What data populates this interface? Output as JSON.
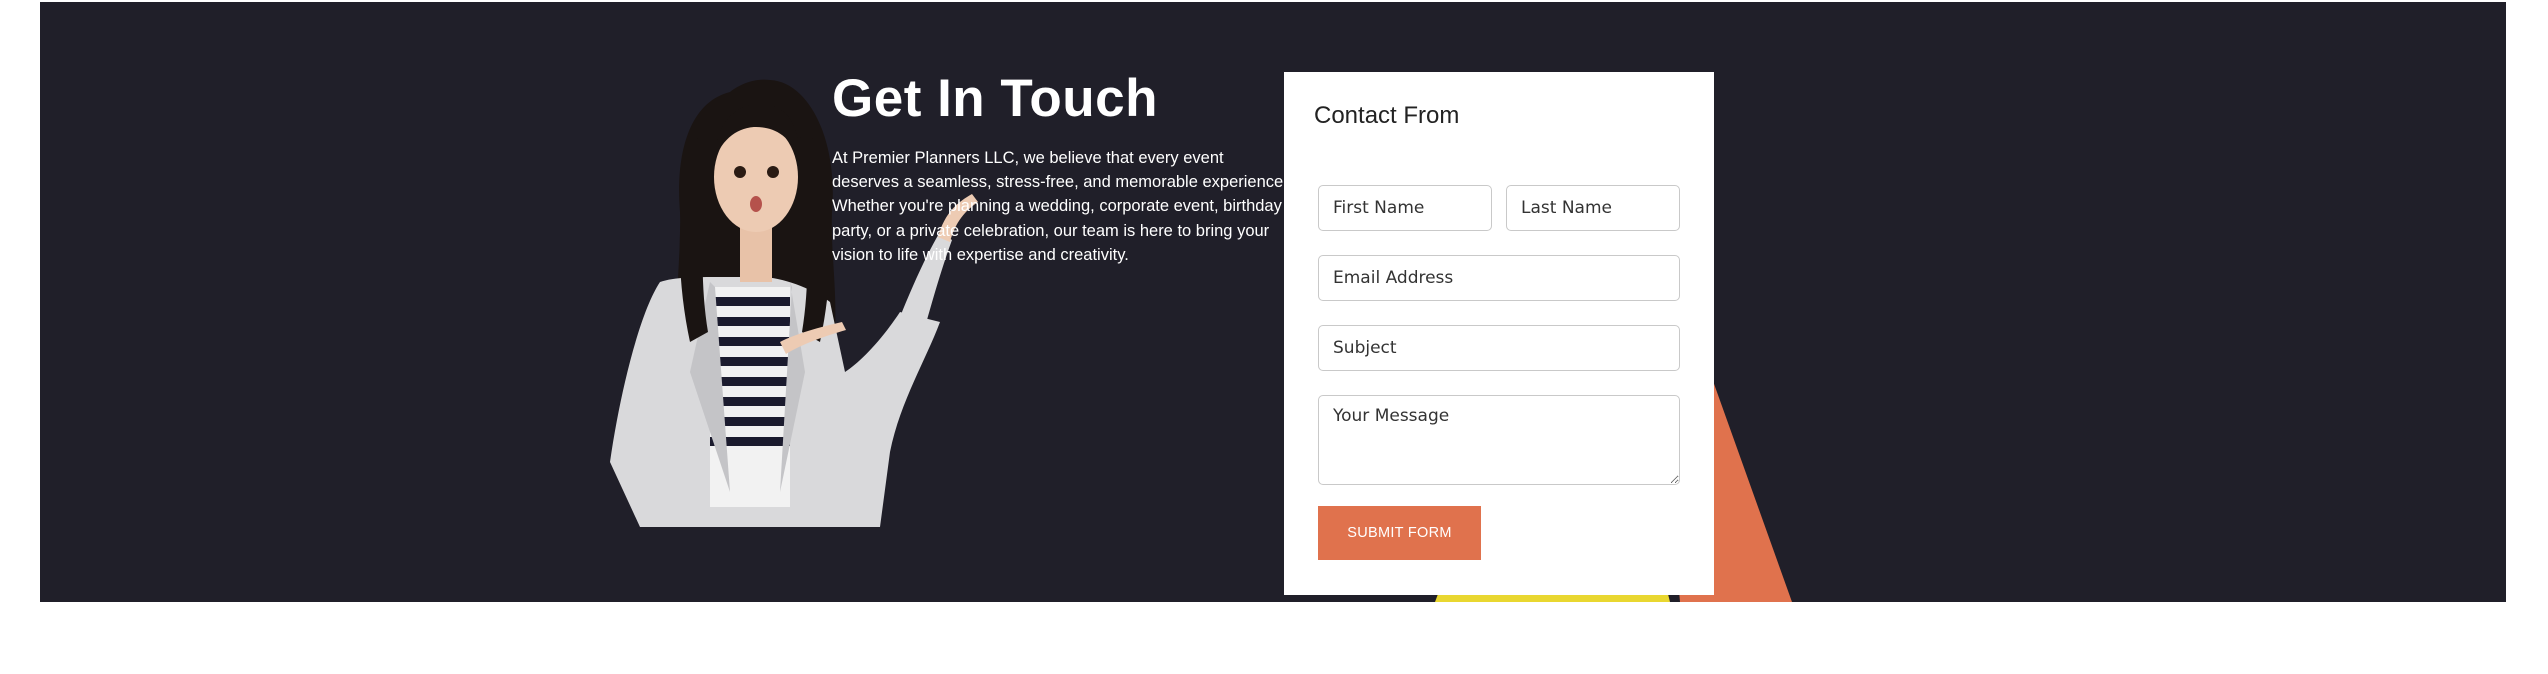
{
  "colors": {
    "band_background": "#201f29",
    "accent_orange": "#e0724d",
    "accent_yellow": "#e9d730",
    "text_light": "#ffffff"
  },
  "hero": {
    "title": "Get In Touch",
    "description": "At Premier Planners LLC, we believe that every event deserves a seamless, stress-free, and memorable experience. Whether you're planning a wedding, corporate event, birthday party, or a private celebration, our team is here to bring your vision to life with expertise and creativity.",
    "image": "woman-pointing-illustration"
  },
  "form": {
    "title": "Contact From",
    "first_name_placeholder": "First Name",
    "last_name_placeholder": "Last Name",
    "email_placeholder": "Email Address",
    "subject_placeholder": "Subject",
    "message_placeholder": "Your Message",
    "submit_label": "SUBMIT FORM"
  }
}
